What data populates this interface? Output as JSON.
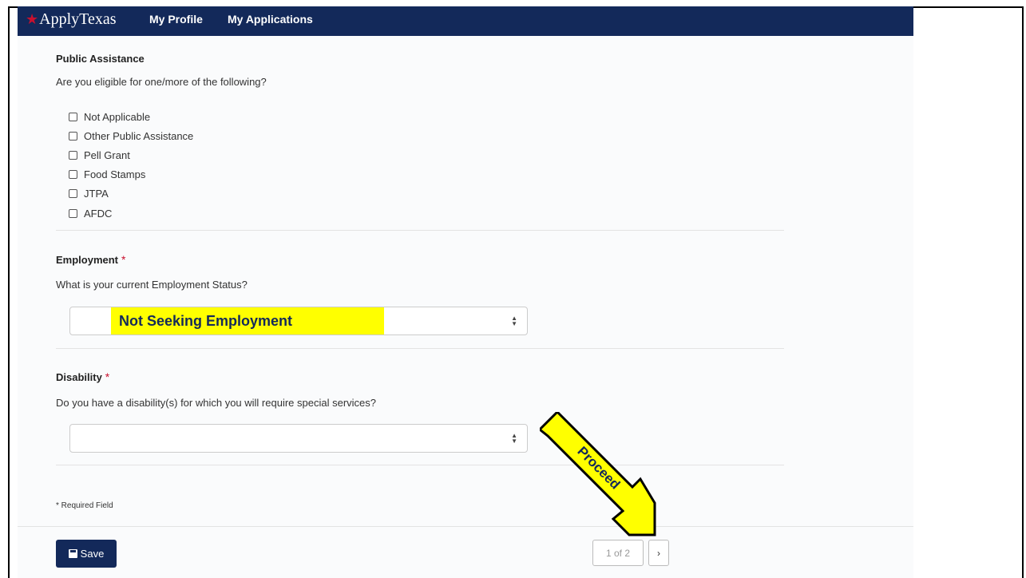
{
  "header": {
    "brand": "ApplyTexas",
    "brand_star": "★",
    "nav": [
      "My Profile",
      "My Applications"
    ]
  },
  "public_assistance": {
    "title": "Public Assistance",
    "question": "Are you eligible for one/more of the following?",
    "options": [
      "Not Applicable",
      "Other Public Assistance",
      "Pell Grant",
      "Food Stamps",
      "JTPA",
      "AFDC"
    ]
  },
  "employment": {
    "title": "Employment",
    "required_mark": "*",
    "question": "What is your current Employment Status?",
    "selected": "Not Seeking Employment"
  },
  "disability": {
    "title": "Disability",
    "required_mark": "*",
    "question": "Do you have a disability(s) for which you will require special services?",
    "selected": ""
  },
  "footer": {
    "required_note": "* Required Field",
    "save_label": "Save",
    "page_indicator": "1 of 2",
    "next_label": "›"
  },
  "annotation": {
    "arrow_label": "Proceed",
    "arrow_color": "#ffff00"
  }
}
